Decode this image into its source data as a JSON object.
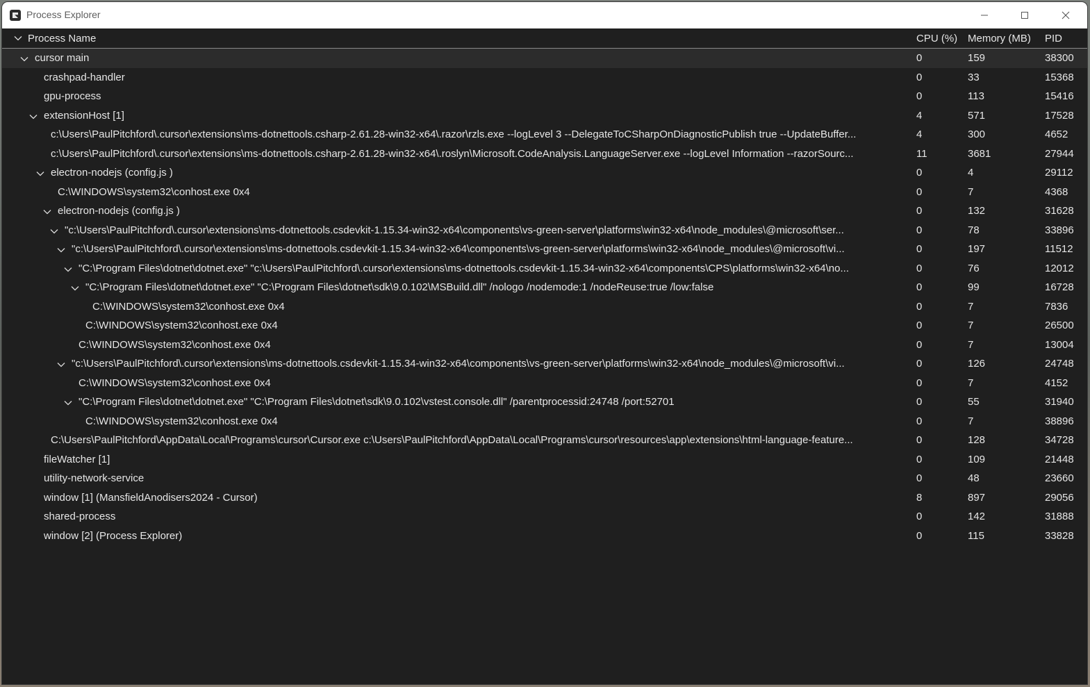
{
  "window": {
    "title": "Process Explorer"
  },
  "columns": {
    "name": "Process Name",
    "cpu": "CPU (%)",
    "memory": "Memory (MB)",
    "pid": "PID"
  },
  "rows": [
    {
      "name": "cursor main",
      "cpu": "0",
      "mem": "159",
      "pid": "38300",
      "depth": 0,
      "expandable": true,
      "selected": true
    },
    {
      "name": "crashpad-handler",
      "cpu": "0",
      "mem": "33",
      "pid": "15368",
      "depth": 1,
      "expandable": false
    },
    {
      "name": "gpu-process",
      "cpu": "0",
      "mem": "113",
      "pid": "15416",
      "depth": 1,
      "expandable": false
    },
    {
      "name": "extensionHost [1]",
      "cpu": "4",
      "mem": "571",
      "pid": "17528",
      "depth": 1,
      "expandable": true
    },
    {
      "name": "c:\\Users\\PaulPitchford\\.cursor\\extensions\\ms-dotnettools.csharp-2.61.28-win32-x64\\.razor\\rzls.exe --logLevel 3 --DelegateToCSharpOnDiagnosticPublish true --UpdateBuffer...",
      "cpu": "4",
      "mem": "300",
      "pid": "4652",
      "depth": 2,
      "expandable": false
    },
    {
      "name": "c:\\Users\\PaulPitchford\\.cursor\\extensions\\ms-dotnettools.csharp-2.61.28-win32-x64\\.roslyn\\Microsoft.CodeAnalysis.LanguageServer.exe --logLevel Information --razorSourc...",
      "cpu": "11",
      "mem": "3681",
      "pid": "27944",
      "depth": 2,
      "expandable": false
    },
    {
      "name": "electron-nodejs (config.js )",
      "cpu": "0",
      "mem": "4",
      "pid": "29112",
      "depth": 2,
      "expandable": true
    },
    {
      "name": "C:\\WINDOWS\\system32\\conhost.exe 0x4",
      "cpu": "0",
      "mem": "7",
      "pid": "4368",
      "depth": 3,
      "expandable": false
    },
    {
      "name": "electron-nodejs (config.js )",
      "cpu": "0",
      "mem": "132",
      "pid": "31628",
      "depth": 3,
      "expandable": true
    },
    {
      "name": "\"c:\\Users\\PaulPitchford\\.cursor\\extensions\\ms-dotnettools.csdevkit-1.15.34-win32-x64\\components\\vs-green-server\\platforms\\win32-x64\\node_modules\\@microsoft\\ser...",
      "cpu": "0",
      "mem": "78",
      "pid": "33896",
      "depth": 4,
      "expandable": true
    },
    {
      "name": "\"c:\\Users\\PaulPitchford\\.cursor\\extensions\\ms-dotnettools.csdevkit-1.15.34-win32-x64\\components\\vs-green-server\\platforms\\win32-x64\\node_modules\\@microsoft\\vi...",
      "cpu": "0",
      "mem": "197",
      "pid": "11512",
      "depth": 5,
      "expandable": true
    },
    {
      "name": "\"C:\\Program Files\\dotnet\\dotnet.exe\" \"c:\\Users\\PaulPitchford\\.cursor\\extensions\\ms-dotnettools.csdevkit-1.15.34-win32-x64\\components\\CPS\\platforms\\win32-x64\\no...",
      "cpu": "0",
      "mem": "76",
      "pid": "12012",
      "depth": 6,
      "expandable": true
    },
    {
      "name": "\"C:\\Program Files\\dotnet\\dotnet.exe\" \"C:\\Program Files\\dotnet\\sdk\\9.0.102\\MSBuild.dll\" /nologo /nodemode:1 /nodeReuse:true /low:false",
      "cpu": "0",
      "mem": "99",
      "pid": "16728",
      "depth": 7,
      "expandable": true
    },
    {
      "name": "C:\\WINDOWS\\system32\\conhost.exe 0x4",
      "cpu": "0",
      "mem": "7",
      "pid": "7836",
      "depth": 8,
      "expandable": false
    },
    {
      "name": "C:\\WINDOWS\\system32\\conhost.exe 0x4",
      "cpu": "0",
      "mem": "7",
      "pid": "26500",
      "depth": 7,
      "expandable": false
    },
    {
      "name": "C:\\WINDOWS\\system32\\conhost.exe 0x4",
      "cpu": "0",
      "mem": "7",
      "pid": "13004",
      "depth": 6,
      "expandable": false
    },
    {
      "name": "\"c:\\Users\\PaulPitchford\\.cursor\\extensions\\ms-dotnettools.csdevkit-1.15.34-win32-x64\\components\\vs-green-server\\platforms\\win32-x64\\node_modules\\@microsoft\\vi...",
      "cpu": "0",
      "mem": "126",
      "pid": "24748",
      "depth": 5,
      "expandable": true
    },
    {
      "name": "C:\\WINDOWS\\system32\\conhost.exe 0x4",
      "cpu": "0",
      "mem": "7",
      "pid": "4152",
      "depth": 6,
      "expandable": false
    },
    {
      "name": "\"C:\\Program Files\\dotnet\\dotnet.exe\" \"C:\\Program Files\\dotnet\\sdk\\9.0.102\\vstest.console.dll\" /parentprocessid:24748 /port:52701",
      "cpu": "0",
      "mem": "55",
      "pid": "31940",
      "depth": 6,
      "expandable": true
    },
    {
      "name": "C:\\WINDOWS\\system32\\conhost.exe 0x4",
      "cpu": "0",
      "mem": "7",
      "pid": "38896",
      "depth": 7,
      "expandable": false
    },
    {
      "name": "C:\\Users\\PaulPitchford\\AppData\\Local\\Programs\\cursor\\Cursor.exe c:\\Users\\PaulPitchford\\AppData\\Local\\Programs\\cursor\\resources\\app\\extensions\\html-language-feature...",
      "cpu": "0",
      "mem": "128",
      "pid": "34728",
      "depth": 2,
      "expandable": false
    },
    {
      "name": "fileWatcher [1]",
      "cpu": "0",
      "mem": "109",
      "pid": "21448",
      "depth": 1,
      "expandable": false
    },
    {
      "name": "utility-network-service",
      "cpu": "0",
      "mem": "48",
      "pid": "23660",
      "depth": 1,
      "expandable": false
    },
    {
      "name": "window [1] (MansfieldAnodisers2024 - Cursor)",
      "cpu": "8",
      "mem": "897",
      "pid": "29056",
      "depth": 1,
      "expandable": false
    },
    {
      "name": "shared-process",
      "cpu": "0",
      "mem": "142",
      "pid": "31888",
      "depth": 1,
      "expandable": false
    },
    {
      "name": "window [2] (Process Explorer)",
      "cpu": "0",
      "mem": "115",
      "pid": "33828",
      "depth": 1,
      "expandable": false
    }
  ]
}
